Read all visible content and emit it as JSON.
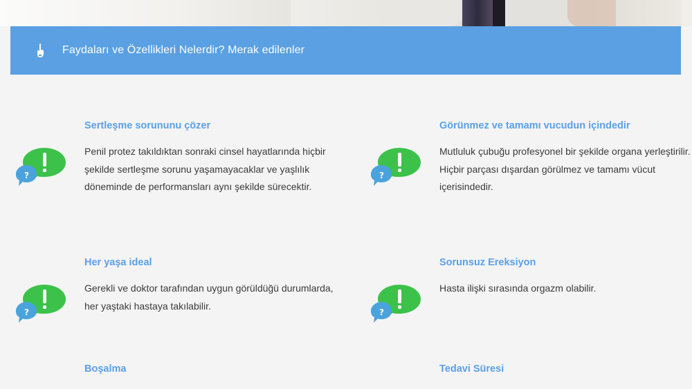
{
  "banner": {
    "title": "Faydaları ve Özellikleri Nelerdir? Merak edilenler",
    "icon": "pointer-hand-icon"
  },
  "colors": {
    "banner_bg": "#5aa0e2",
    "heading": "#5aa0e8",
    "body_text": "#3a3a3a",
    "bubble_green": "#3cc24b",
    "bubble_blue": "#4aa3dd"
  },
  "features": [
    {
      "heading": "Sertleşme sorununu çözer",
      "text": "Penil protez takıldıktan sonraki cinsel hayatlarında hiçbir şekilde sertleşme sorunu yaşamayacaklar ve yaşlılık döneminde de performansları aynı şekilde sürecektir."
    },
    {
      "heading": "Görünmez ve tamamı vucudun içindedir",
      "text": "Mutluluk çubuğu profesyonel bir şekilde organa yerleştirilir. Hiçbir parçası dışardan görülmez ve tamamı vücut içerisindedir."
    },
    {
      "heading": "Her yaşa ideal",
      "text": "Gerekli ve doktor tarafından uygun görüldüğü durumlarda, her yaştaki hastaya takılabilir."
    },
    {
      "heading": "Sorunsuz Ereksiyon",
      "text": "Hasta ilişki sırasında orgazm olabilir."
    },
    {
      "heading": "Boşalma",
      "text": ""
    },
    {
      "heading": "Tedavi Süresi",
      "text": ""
    }
  ]
}
